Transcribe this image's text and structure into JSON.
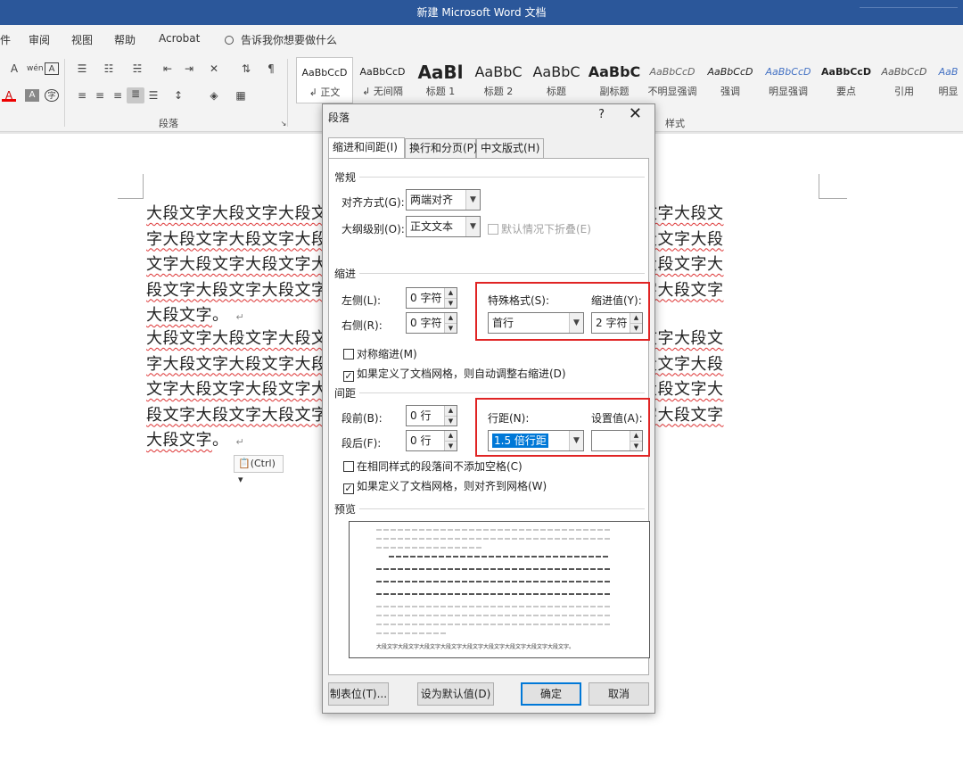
{
  "window": {
    "title": "新建 Microsoft Word 文档"
  },
  "menu": {
    "items": [
      "件",
      "审阅",
      "视图",
      "帮助",
      "Acrobat"
    ],
    "tell_me": "告诉我你想要做什么"
  },
  "ribbon": {
    "paragraph_group_label": "段落",
    "styles_group_label": "样式",
    "styles": [
      {
        "sample": "AaBbCcD",
        "label": "正文"
      },
      {
        "sample": "AaBbCcD",
        "label": "无间隔"
      },
      {
        "sample": "AaBl",
        "label": "标题 1"
      },
      {
        "sample": "AaBbC",
        "label": "标题 2"
      },
      {
        "sample": "AaBbC",
        "label": "标题"
      },
      {
        "sample": "AaBbC",
        "label": "副标题"
      },
      {
        "sample": "AaBbCcD",
        "label": "不明显强调"
      },
      {
        "sample": "AaBbCcD",
        "label": "强调"
      },
      {
        "sample": "AaBbCcD",
        "label": "明显强调"
      },
      {
        "sample": "AaBbCcD",
        "label": "要点"
      },
      {
        "sample": "AaBbCcD",
        "label": "引用"
      },
      {
        "sample": "AaB",
        "label": "明显"
      }
    ]
  },
  "document": {
    "para1": [
      "大段文字大段文字大段文字大段文字大段文字大段文字大段文字大段文字大段文",
      "字大段文字大段文字大段文字大段文字大段文字大段文字大段文字大段文字大段",
      "文字大段文字大段文字大段文字大段文字大段文字大段文字大段文字大段文字大",
      "段文字大段文字大段文字大段文字大段文字大段文字大段文字大段文字大段文字"
    ],
    "para1_last": "大段文字",
    "para2": [
      "大段文字大段文字大段文字大段文字大段文字大段文字大段文字大段文字大段文",
      "字大段文字大段文字大段文字大段文字大段文字大段文字大段文字大段文字大段",
      "文字大段文字大段文字大段文字大段文字大段文字大段文字大段文字大段文字大",
      "段文字大段文字大段文字大段文字大段文字大段文字大段文字大段文字大段文字"
    ],
    "para2_last": "大段文字",
    "period": "。",
    "return_mark": "↵",
    "paste_options": "(Ctrl)"
  },
  "dialog": {
    "title": "段落",
    "help": "?",
    "close": "✕",
    "tabs": [
      "缩进和间距(I)",
      "换行和分页(P)",
      "中文版式(H)"
    ],
    "general": {
      "section": "常规",
      "alignment_label": "对齐方式(G):",
      "alignment_value": "两端对齐",
      "outline_label": "大纲级别(O):",
      "outline_value": "正文文本",
      "collapse_label": "默认情况下折叠(E)"
    },
    "indent": {
      "section": "缩进",
      "left_label": "左侧(L):",
      "left_value": "0 字符",
      "right_label": "右侧(R):",
      "right_value": "0 字符",
      "special_label": "特殊格式(S):",
      "special_value": "首行",
      "by_label": "缩进值(Y):",
      "by_value": "2 字符",
      "mirror_label": "对称缩进(M)",
      "auto_right_label": "如果定义了文档网格，则自动调整右缩进(D)"
    },
    "spacing": {
      "section": "间距",
      "before_label": "段前(B):",
      "before_value": "0 行",
      "after_label": "段后(F):",
      "after_value": "0 行",
      "line_label": "行距(N):",
      "line_value": "1.5 倍行距",
      "at_label": "设置值(A):",
      "at_value": "",
      "no_space_label": "在相同样式的段落间不添加空格(C)",
      "snap_grid_label": "如果定义了文档网格，则对齐到网格(W)"
    },
    "preview": {
      "section": "预览",
      "sample_text": "大段文字大段文字大段文字大段文字大段文字大段文字大段文字大段文字大段文字。"
    },
    "buttons": {
      "tabs": "制表位(T)...",
      "set_default": "设为默认值(D)",
      "ok": "确定",
      "cancel": "取消"
    }
  }
}
